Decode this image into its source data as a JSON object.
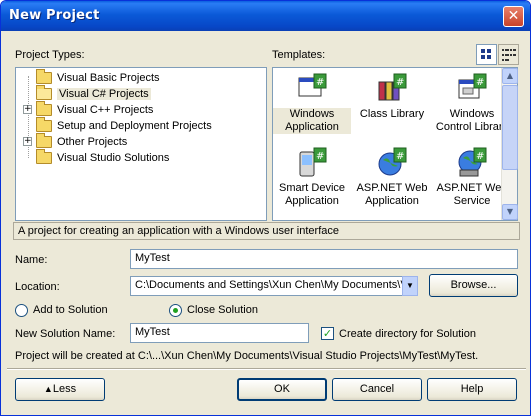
{
  "window": {
    "title": "New Project",
    "close_label": "✕"
  },
  "labels": {
    "project_types": "Project Types:",
    "templates": "Templates:"
  },
  "project_types": [
    {
      "label": "Visual Basic Projects",
      "expandable": false,
      "selected": false
    },
    {
      "label": "Visual C# Projects",
      "expandable": false,
      "selected": true
    },
    {
      "label": "Visual C++ Projects",
      "expandable": true,
      "selected": false
    },
    {
      "label": "Setup and Deployment Projects",
      "expandable": false,
      "selected": false
    },
    {
      "label": "Other Projects",
      "expandable": true,
      "selected": false
    },
    {
      "label": "Visual Studio Solutions",
      "expandable": false,
      "selected": false
    }
  ],
  "templates": [
    {
      "label": "Windows Application",
      "icon": "windows-application-icon",
      "selected": true
    },
    {
      "label": "Class Library",
      "icon": "class-library-icon",
      "selected": false
    },
    {
      "label": "Windows Control Library",
      "icon": "windows-control-library-icon",
      "selected": false
    },
    {
      "label": "Smart Device Application",
      "icon": "smart-device-icon",
      "selected": false
    },
    {
      "label": "ASP.NET Web Application",
      "icon": "aspnet-web-app-icon",
      "selected": false
    },
    {
      "label": "ASP.NET Web Service",
      "icon": "aspnet-web-service-icon",
      "selected": false
    }
  ],
  "description": "A project for creating an application with a Windows user interface",
  "form": {
    "name_label": "Name:",
    "name_value": "MyTest",
    "location_label": "Location:",
    "location_value": "C:\\Documents and Settings\\Xun Chen\\My Documents\\V",
    "browse_label": "Browse...",
    "add_to_solution_label": "Add to Solution",
    "close_solution_label": "Close Solution",
    "new_solution_name_label": "New Solution Name:",
    "new_solution_name_value": "MyTest",
    "create_directory_label": "Create directory for Solution",
    "project_path_text": "Project will be created at C:\\...\\Xun Chen\\My Documents\\Visual Studio Projects\\MyTest\\MyTest."
  },
  "buttons": {
    "less": "Less",
    "ok": "OK",
    "cancel": "Cancel",
    "help": "Help"
  },
  "colors": {
    "title_bar": "#0b5ad8",
    "dialog_bg": "#ece9d8",
    "field_border": "#7f9db9"
  }
}
